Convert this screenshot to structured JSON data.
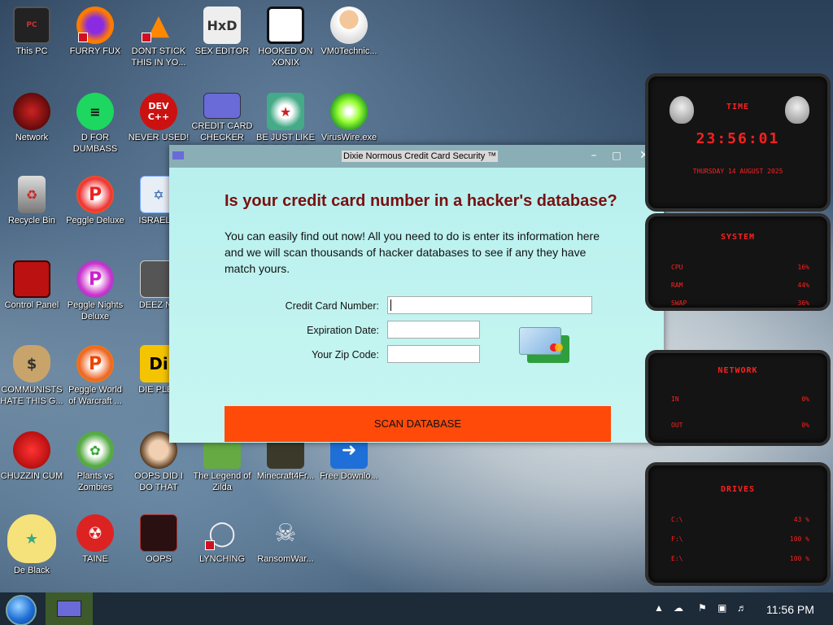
{
  "desktop_icons": [
    {
      "label": "This PC",
      "icon": "computer-icon"
    },
    {
      "label": "FURRY FUX",
      "icon": "firefox-icon"
    },
    {
      "label": "DONT STICK THIS IN YO...",
      "icon": "vlc-cone-icon"
    },
    {
      "label": "SEX EDITOR",
      "icon": "hxd-editor-icon"
    },
    {
      "label": "HOOKED ON XONIX",
      "icon": "xonix-game-icon"
    },
    {
      "label": "VM0Technic...",
      "icon": "doctor-icon"
    },
    {
      "label": "Network",
      "icon": "network-icon"
    },
    {
      "label": "D FOR DUMBASS",
      "icon": "spotify-icon"
    },
    {
      "label": "NEVER USED!",
      "icon": "devcpp-icon"
    },
    {
      "label": "CREDIT CARD CHECKER",
      "icon": "credit-card-icon"
    },
    {
      "label": "BE JUST LIKE THE DUDE!",
      "icon": "santa-dude-icon"
    },
    {
      "label": "VirusWire.exe",
      "icon": "lime-icon"
    },
    {
      "label": "Recycle Bin",
      "icon": "recycle-bin-icon"
    },
    {
      "label": "Peggle Deluxe",
      "icon": "peggle-icon"
    },
    {
      "label": "ISRAEL S",
      "icon": "israel-icon"
    },
    {
      "label": "Control Panel",
      "icon": "control-panel-icon"
    },
    {
      "label": "Peggle Nights Deluxe",
      "icon": "peggle-nights-icon"
    },
    {
      "label": "DEEZ NU",
      "icon": "deez-icon"
    },
    {
      "label": "COMMUNISTS HATE THIS G...",
      "icon": "money-bag-icon"
    },
    {
      "label": "Peggle World of Warcraft ...",
      "icon": "peggle-wow-icon"
    },
    {
      "label": "DIE PLEA",
      "icon": "die-icon"
    },
    {
      "label": "CHUZZIN CUM",
      "icon": "chuzzle-icon"
    },
    {
      "label": "Plants vs Zombies",
      "icon": "pvz-icon"
    },
    {
      "label": "OOPS DID I DO THAT",
      "icon": "portrait-icon"
    },
    {
      "label": "The Legend of Zilda",
      "icon": "zelda-icon"
    },
    {
      "label": "Minecraft4Fr...",
      "icon": "minecraft-icon"
    },
    {
      "label": "Free Downlo...",
      "icon": "download-arrow-icon"
    },
    {
      "label": "De Black",
      "icon": "star-butterfly-icon"
    },
    {
      "label": "TAINE",
      "icon": "radiation-icon"
    },
    {
      "label": "OOPS",
      "icon": "oops-icon"
    },
    {
      "label": "LYNCHING",
      "icon": "noose-icon"
    },
    {
      "label": "RansomWar...",
      "icon": "skull-icon"
    }
  ],
  "window": {
    "title": "Dixie Normous Credit Card Security ™",
    "heading": "Is your credit card number in a hacker's database?",
    "description": "You can easily find out now! All you need to do is enter its information here and we will scan thousands of hacker databases to see if any they have match yours.",
    "fields": {
      "card_label": "Credit Card Number:",
      "card_value": "",
      "exp_label": "Expiration Date:",
      "exp_value": "",
      "zip_label": "Your Zip Code:",
      "zip_value": ""
    },
    "button": "SCAN DATABASE",
    "minimize": "–",
    "maximize": "□",
    "close": "✕"
  },
  "widget": {
    "time_title": "TIME",
    "time": "23:56:01",
    "date": "THURSDAY 14 AUGUST 2025",
    "system_title": "SYSTEM",
    "cpu_label": "CPU",
    "cpu": "16%",
    "ram_label": "RAM",
    "ram": "44%",
    "swap_label": "SWAP",
    "swap": "36%",
    "network_title": "NETWORK",
    "in_label": "IN",
    "in": "0%",
    "out_label": "OUT",
    "out": "0%",
    "drives_title": "DRIVES",
    "c_label": "C:\\",
    "c": "43 %",
    "f_label": "F:\\",
    "f": "100 %",
    "e_label": "E:\\",
    "e": "100 %"
  },
  "taskbar": {
    "clock": "11:56 PM"
  },
  "colors": {
    "accent_red": "#ff2020",
    "button_orange": "#ff4a0a",
    "heading_red": "#7a1010",
    "window_bg": "#bfeeee"
  }
}
